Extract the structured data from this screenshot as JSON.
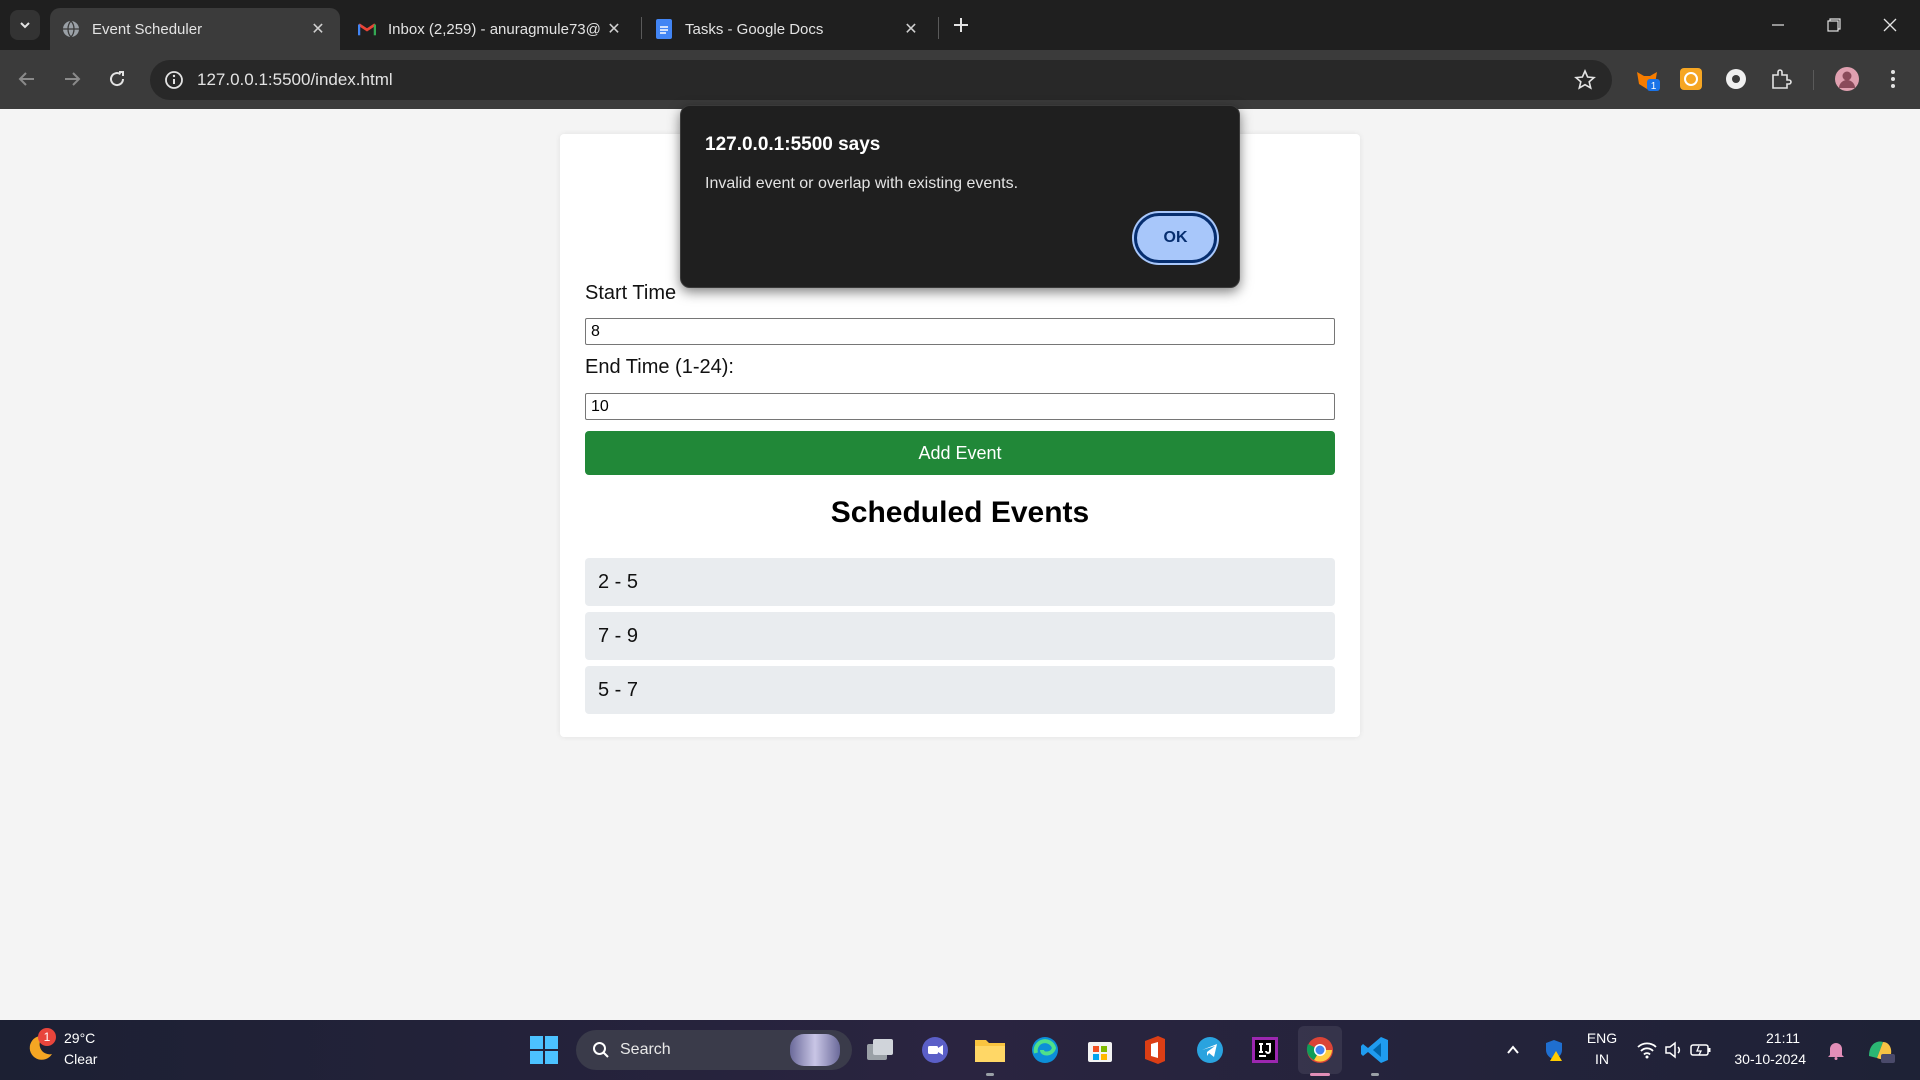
{
  "browser": {
    "tabs": [
      {
        "title": "Event Scheduler",
        "active": true
      },
      {
        "title": "Inbox (2,259) - anuragmule73@",
        "active": false
      },
      {
        "title": "Tasks - Google Docs",
        "active": false
      }
    ],
    "url": "127.0.0.1:5500/index.html",
    "extension_badge": "1"
  },
  "form": {
    "start_label": "Start Time",
    "start_value": "8",
    "end_label": "End Time (1-24):",
    "end_value": "10",
    "add_button": "Add Event"
  },
  "scheduled": {
    "title": "Scheduled Events",
    "events": [
      "2 - 5",
      "7 - 9",
      "5 - 7"
    ]
  },
  "dialog": {
    "title": "127.0.0.1:5500 says",
    "message": "Invalid event or overlap with existing events.",
    "ok_label": "OK"
  },
  "taskbar": {
    "weather_badge": "1",
    "temperature": "29°C",
    "weather": "Clear",
    "search_label": "Search",
    "language_line1": "ENG",
    "language_line2": "IN",
    "time": "21:11",
    "date": "30-10-2024"
  },
  "colors": {
    "add_button": "#218838",
    "event_item": "#e9ecef",
    "ok_button": "#a8c7fa"
  }
}
